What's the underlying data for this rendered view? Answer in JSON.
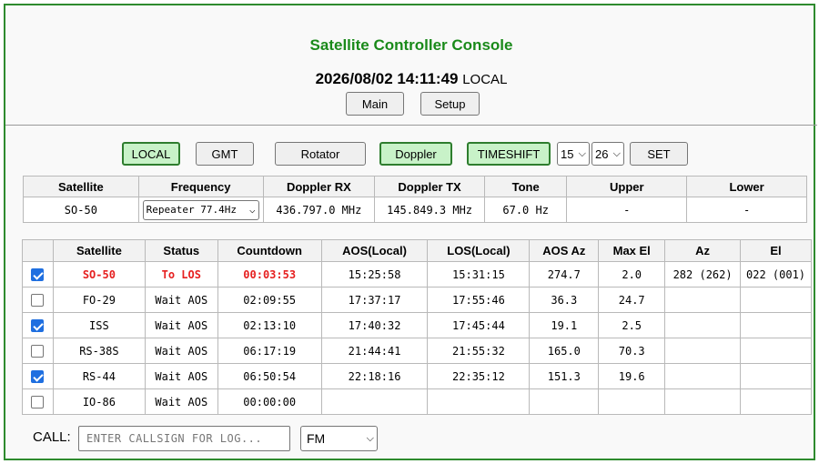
{
  "header": {
    "title": "Satellite Controller Console",
    "datetime": "2026/08/02 14:11:49",
    "timezone": "LOCAL",
    "main_label": "Main",
    "setup_label": "Setup"
  },
  "controls": {
    "local": "LOCAL",
    "gmt": "GMT",
    "rotator": "Rotator",
    "doppler": "Doppler",
    "timeshift": "TIMESHIFT",
    "hour": "15",
    "minute": "26",
    "set": "SET"
  },
  "current": {
    "headers": [
      "Satellite",
      "Frequency",
      "Doppler RX",
      "Doppler TX",
      "Tone",
      "Upper",
      "Lower"
    ],
    "satellite": "SO-50",
    "frequency": "Repeater 77.4Hz",
    "doppler_rx": "436.797.0 MHz",
    "doppler_tx": "145.849.3 MHz",
    "tone": "67.0 Hz",
    "upper": "-",
    "lower": "-"
  },
  "passes": {
    "headers": [
      "Satellite",
      "Status",
      "Countdown",
      "AOS(Local)",
      "LOS(Local)",
      "AOS Az",
      "Max El",
      "Az",
      "El"
    ],
    "rows": [
      {
        "checked": true,
        "sat": "SO-50",
        "status": "To LOS",
        "countdown": "00:03:53",
        "aos": "15:25:58",
        "los": "15:31:15",
        "aos_az": "274.7",
        "max_el": "2.0",
        "az": "282 (262)",
        "el": "022 (001)",
        "active": true
      },
      {
        "checked": false,
        "sat": "FO-29",
        "status": "Wait AOS",
        "countdown": "02:09:55",
        "aos": "17:37:17",
        "los": "17:55:46",
        "aos_az": "36.3",
        "max_el": "24.7",
        "az": "",
        "el": ""
      },
      {
        "checked": true,
        "sat": "ISS",
        "status": "Wait AOS",
        "countdown": "02:13:10",
        "aos": "17:40:32",
        "los": "17:45:44",
        "aos_az": "19.1",
        "max_el": "2.5",
        "az": "",
        "el": ""
      },
      {
        "checked": false,
        "sat": "RS-38S",
        "status": "Wait AOS",
        "countdown": "06:17:19",
        "aos": "21:44:41",
        "los": "21:55:32",
        "aos_az": "165.0",
        "max_el": "70.3",
        "az": "",
        "el": ""
      },
      {
        "checked": true,
        "sat": "RS-44",
        "status": "Wait AOS",
        "countdown": "06:50:54",
        "aos": "22:18:16",
        "los": "22:35:12",
        "aos_az": "151.3",
        "max_el": "19.6",
        "az": "",
        "el": ""
      },
      {
        "checked": false,
        "sat": "IO-86",
        "status": "Wait AOS",
        "countdown": "00:00:00",
        "aos": "",
        "los": "",
        "aos_az": "",
        "max_el": "",
        "az": "",
        "el": ""
      }
    ]
  },
  "log": {
    "call_label": "CALL:",
    "call_placeholder": "ENTER CALLSIGN FOR LOG...",
    "mode": "FM"
  },
  "colors": {
    "title": "#1a8a1a",
    "active_row_text": "#e62020",
    "frame": "#2e8b2e",
    "checkbox": "#1f6fe0",
    "toggle_on": "#c8f2c8"
  }
}
